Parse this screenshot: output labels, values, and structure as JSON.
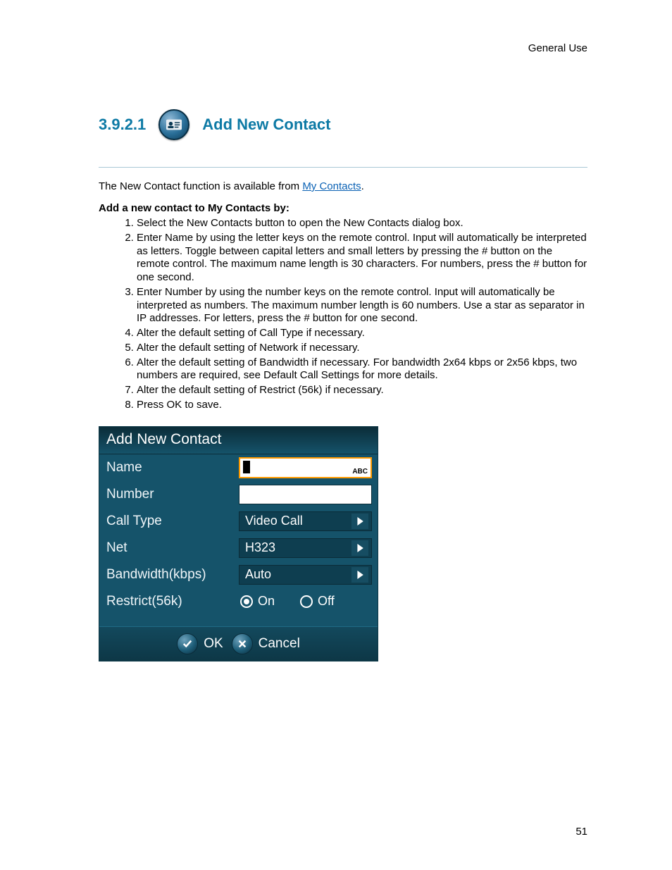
{
  "header_label": "General Use",
  "section_number": "3.9.2.1",
  "section_title": "Add New Contact",
  "intro_prefix": "The New Contact function is available from ",
  "intro_link": "My Contacts",
  "intro_suffix": ".",
  "sub_heading": "Add a new contact to My Contacts by:",
  "steps": [
    "Select the New Contacts button to open the New Contacts dialog box.",
    "Enter Name by using the letter keys on the remote control. Input will automatically be interpreted as letters. Toggle between capital letters and small letters by pressing the # button on the remote control. The maximum name length is 30 characters. For numbers, press the # button for one second.",
    "Enter Number by using the number keys on the remote control. Input will automatically be interpreted as numbers. The maximum number length is 60 numbers. Use a star as separator in IP addresses. For letters, press the # button for one second.",
    "Alter the default setting of Call Type if necessary.",
    "Alter the default setting of Network if necessary.",
    "Alter the default setting of Bandwidth if necessary. For bandwidth 2x64 kbps or 2x56 kbps, two numbers are required, see Default Call Settings for more details.",
    "Alter the default setting of Restrict (56k) if necessary.",
    "Press OK to save."
  ],
  "dialog": {
    "title": "Add New Contact",
    "fields": {
      "name_label": "Name",
      "name_mode": "ABC",
      "number_label": "Number",
      "call_type_label": "Call Type",
      "call_type_value": "Video Call",
      "net_label": "Net",
      "net_value": "H323",
      "bandwidth_label": "Bandwidth(kbps)",
      "bandwidth_value": "Auto",
      "restrict_label": "Restrict(56k)",
      "restrict_on": "On",
      "restrict_off": "Off"
    },
    "buttons": {
      "ok": "OK",
      "cancel": "Cancel"
    }
  },
  "page_number": "51"
}
